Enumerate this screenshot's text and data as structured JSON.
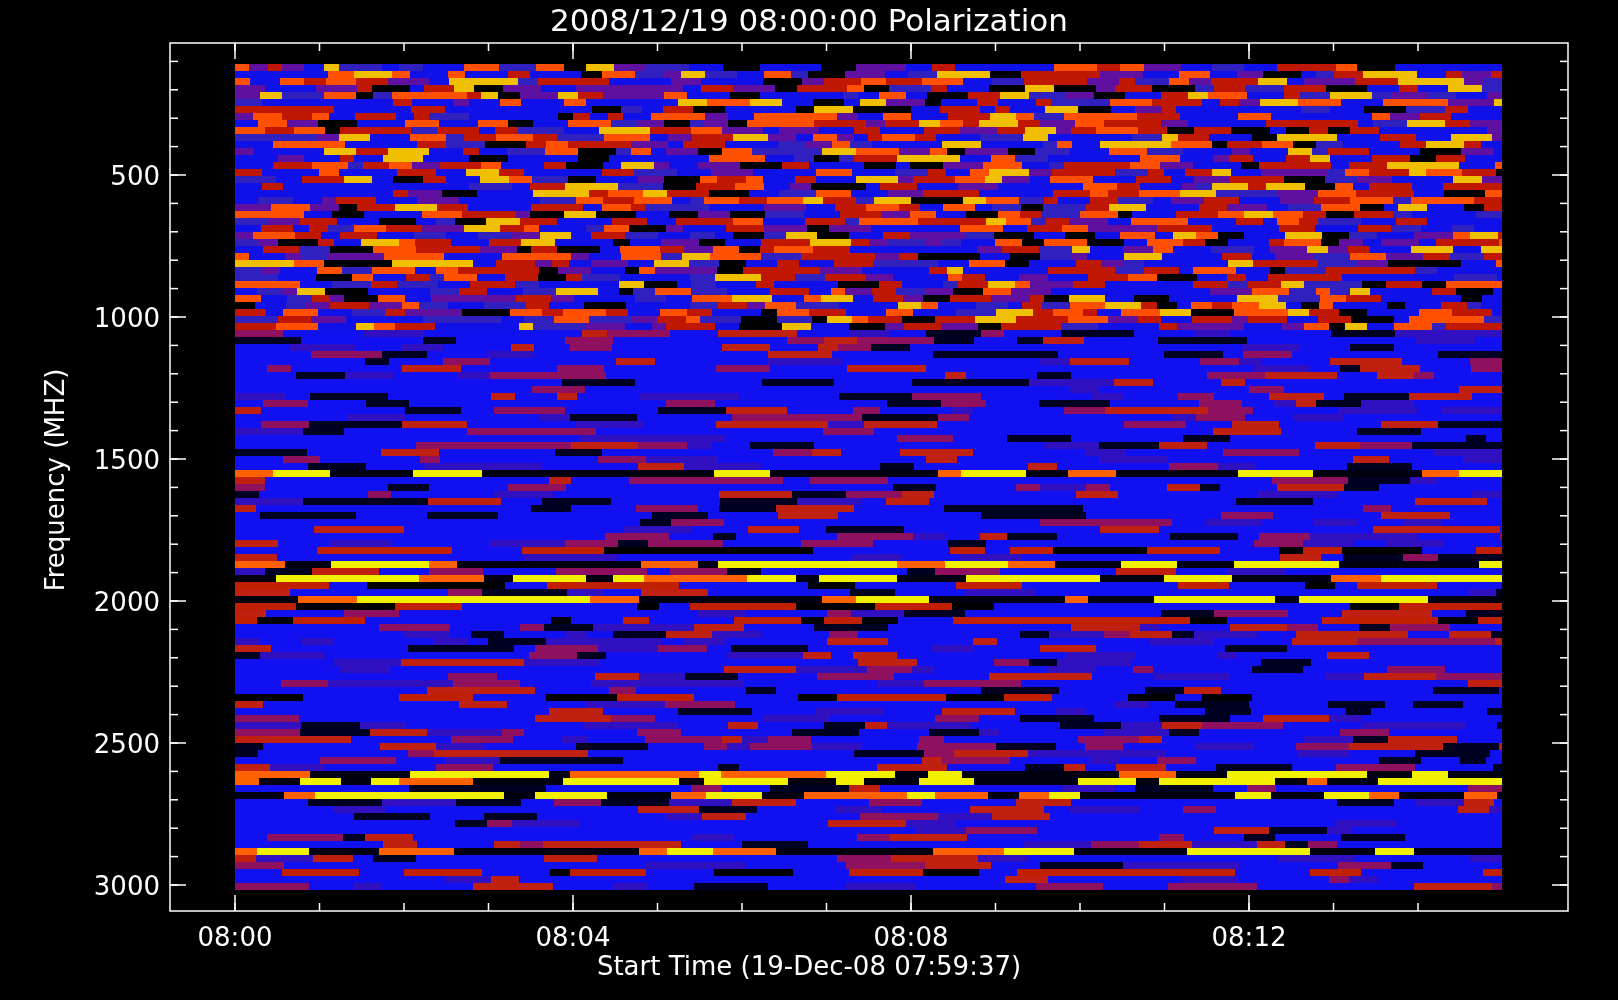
{
  "title": "2008/12/19 08:00:00 Polarization",
  "y_axis": {
    "label": "Frequency (MHZ)",
    "ticks": [
      "500",
      "1000",
      "1500",
      "2000",
      "2500",
      "3000"
    ]
  },
  "x_axis": {
    "label": "Start Time (19-Dec-08 07:59:37)",
    "ticks": [
      "08:00",
      "08:04",
      "08:08",
      "08:12"
    ]
  }
}
